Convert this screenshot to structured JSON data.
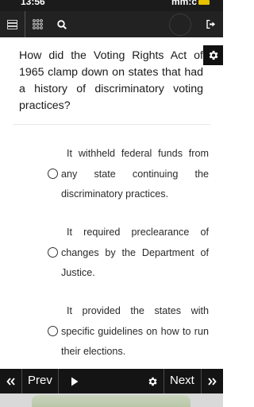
{
  "status_bar": {
    "time": "13:56",
    "right_text": "mm:c"
  },
  "question": {
    "text": "How did the Voting Rights Act of 1965 clamp down on states that had a history of discriminatory voting practices?"
  },
  "options": [
    {
      "label": "It withheld federal funds from any state continuing the discriminatory practices."
    },
    {
      "label": "It required preclearance of changes by the Department of Justice."
    },
    {
      "label": "It provided the states with specific guidelines on how to run their elections."
    }
  ],
  "bottom_nav": {
    "prev_label": "Prev",
    "next_label": "Next"
  },
  "colors": {
    "toolbar": "#222222",
    "bottom_nav": "#141414",
    "background": "#ffffff"
  },
  "icons": [
    "list-icon",
    "grid-icon",
    "search-icon",
    "exit-icon",
    "gear-icon",
    "play-icon",
    "double-chevron-left-icon",
    "double-chevron-right-icon"
  ]
}
